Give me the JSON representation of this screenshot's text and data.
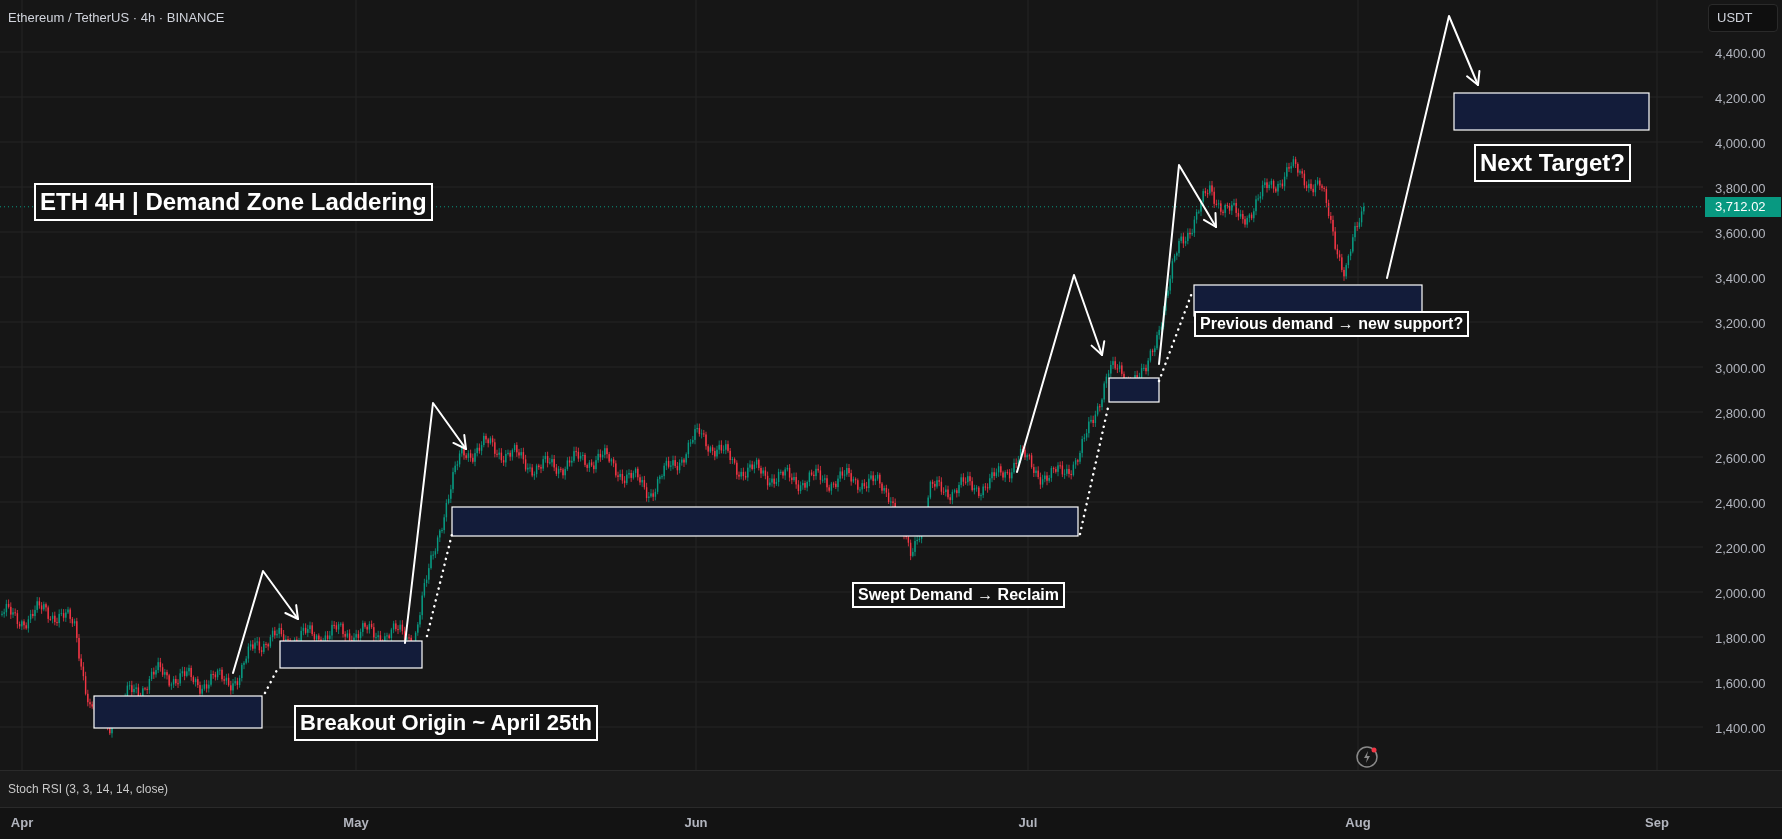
{
  "chart_header": {
    "symbol_line": "Ethereum / TetherUS · 4h · BINANCE"
  },
  "currency_button": "USDT",
  "price_axis": {
    "labels": [
      "4,400.00",
      "4,200.00",
      "4,000.00",
      "3,800.00",
      "3,600.00",
      "3,400.00",
      "3,200.00",
      "3,000.00",
      "2,800.00",
      "2,600.00",
      "2,400.00",
      "2,200.00",
      "2,000.00",
      "1,800.00",
      "1,600.00",
      "1,400.00"
    ],
    "last_price": "3,712.02"
  },
  "annotations": [
    {
      "kind": "large",
      "text": "ETH 4H | Demand Zone Laddering"
    },
    {
      "kind": "large",
      "text": "Next Target?"
    },
    {
      "kind": "small",
      "text": "Previous demand → new support?"
    },
    {
      "kind": "small",
      "text": "Swept Demand → Reclaim"
    },
    {
      "kind": "medium",
      "text": "Breakout Origin ~ April 25th"
    }
  ],
  "indicator_pane": {
    "label": "Stoch RSI (3, 3, 14, 14, close)"
  },
  "time_axis": {
    "labels": [
      "Apr",
      "May",
      "Jun",
      "Jul",
      "Aug",
      "Sep"
    ]
  }
}
